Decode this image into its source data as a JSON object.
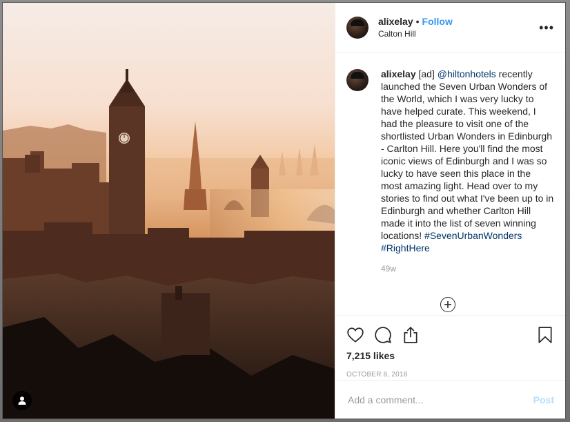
{
  "post": {
    "username": "alixelay",
    "separator": "•",
    "follow_label": "Follow",
    "location": "Calton Hill",
    "more_label": "•••",
    "caption": {
      "username": "alixelay",
      "ad_tag": "[ad]",
      "mention": "@hiltonhotels",
      "text": " recently launched the Seven Urban Wonders of the World, which I was very lucky to have helped curate. This weekend, I had the pleasure to visit one of the shortlisted Urban Wonders in Edinburgh - Carlton Hill. Here you'll find the most iconic views of Edinburgh and I was so lucky to have seen this place in the most amazing light. Head over to my stories to find out what I've been up to in Edinburgh and whether Carlton Hill made it into the list of seven winning locations! ",
      "hashtag1": "#SevenUrbanWonders",
      "hashtag2": "#RightHere"
    },
    "age": "49w",
    "likes": "7,215 likes",
    "date": "OCTOBER 8, 2018",
    "comment_placeholder": "Add a comment...",
    "post_label": "Post"
  },
  "icons": {
    "like": "heart-icon",
    "comment": "comment-icon",
    "share": "share-icon",
    "save": "bookmark-icon",
    "more": "plus-circle-icon",
    "user_tag": "user-icon"
  },
  "colors": {
    "link": "#003569",
    "follow": "#3897f0",
    "post_disabled": "#b2dffc"
  }
}
